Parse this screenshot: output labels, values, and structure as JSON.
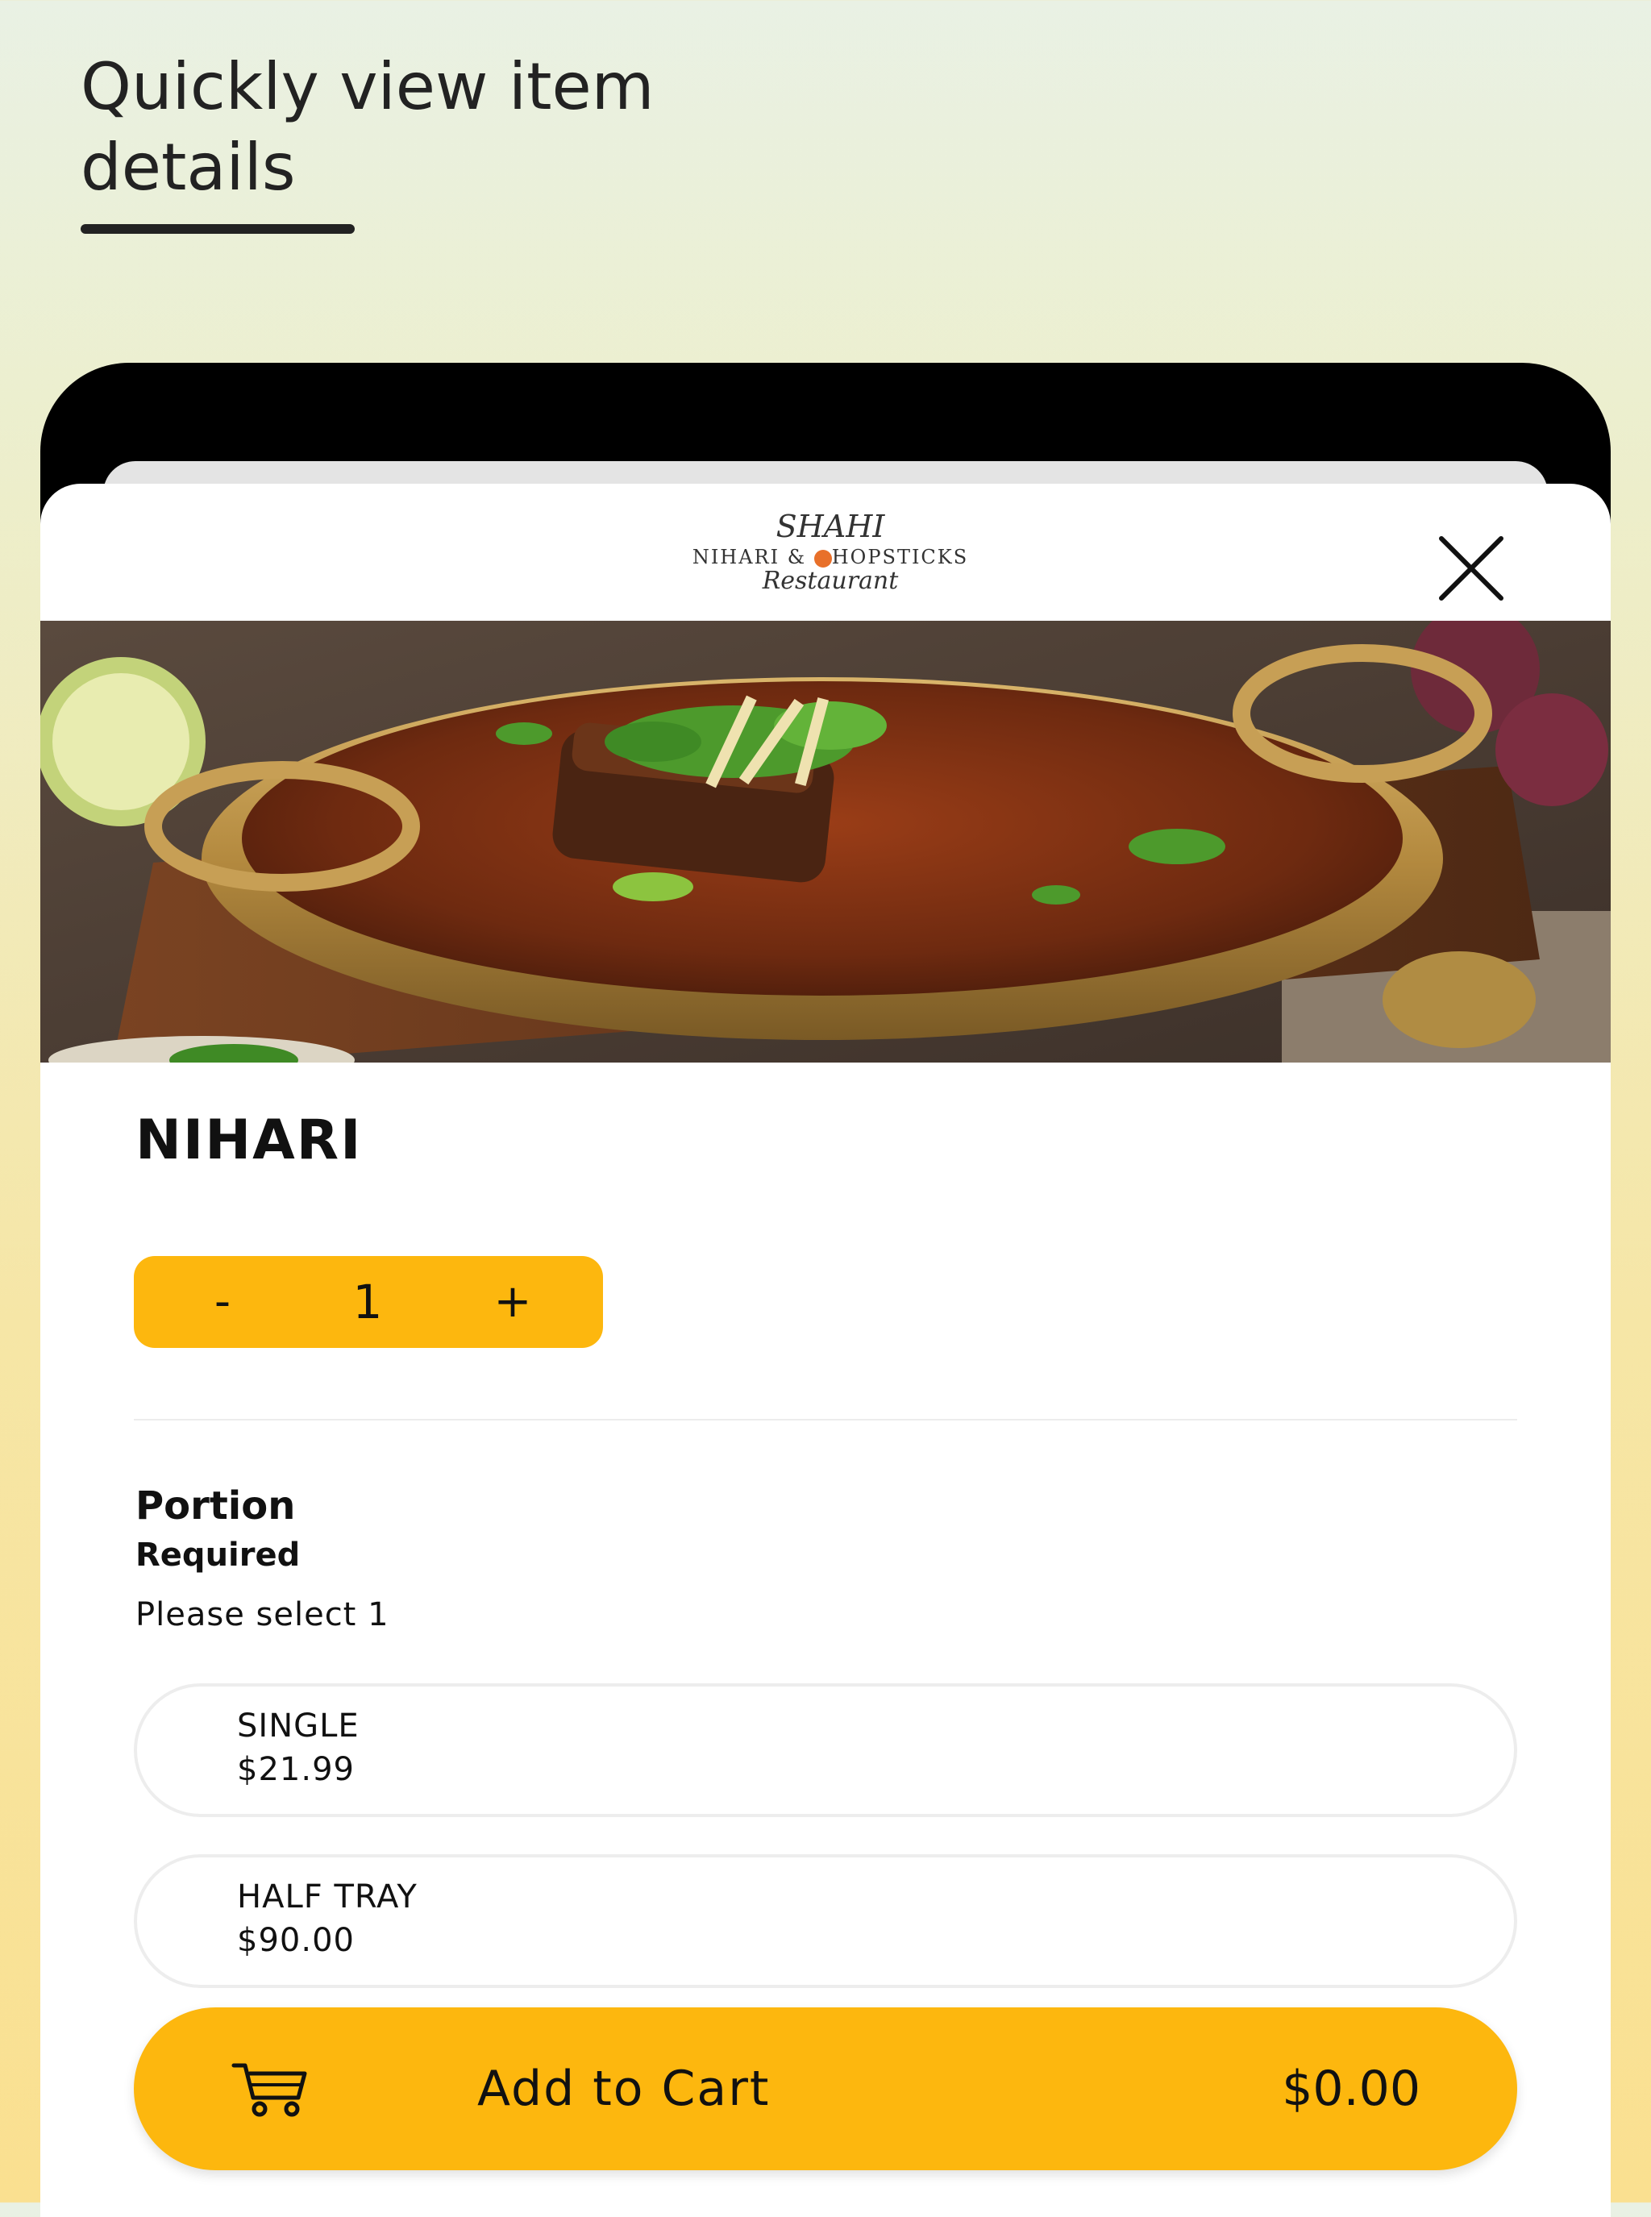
{
  "promo": {
    "title": "Quickly view item details"
  },
  "header": {
    "logo": {
      "line1": "SHAHI",
      "line2a": "NIHARI &",
      "line2b": "HOPSTICKS",
      "line3": "Restaurant"
    },
    "close_icon": "close-icon"
  },
  "item": {
    "name": "NIHARI",
    "image_icon": "food-photo"
  },
  "stepper": {
    "minus": "-",
    "quantity": "1",
    "plus": "+"
  },
  "option_group": {
    "title": "Portion",
    "required": "Required",
    "hint": "Please select 1",
    "options": [
      {
        "name": "SINGLE",
        "price": "$21.99"
      },
      {
        "name": "HALF TRAY",
        "price": "$90.00"
      }
    ]
  },
  "cart": {
    "icon": "cart-icon",
    "label": "Add to Cart",
    "price": "$0.00"
  },
  "colors": {
    "accent": "#fdb70e",
    "text": "#111111"
  }
}
